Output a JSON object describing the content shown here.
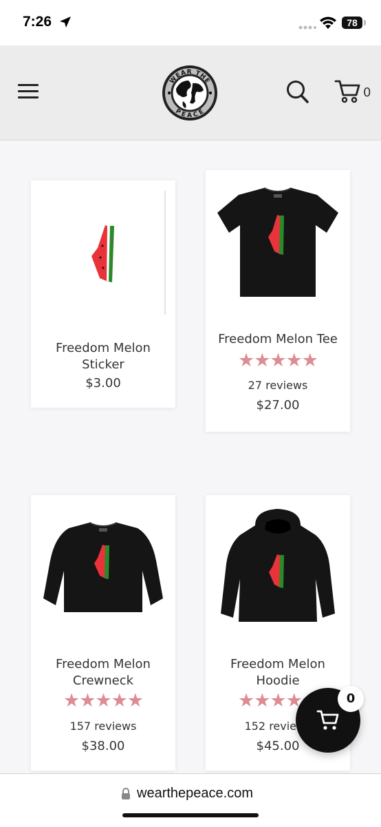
{
  "status_bar": {
    "time": "7:26",
    "battery": "78"
  },
  "header": {
    "logo_text_top": "WEAR THE",
    "logo_text_bottom": "PEACE",
    "cart_count": "0"
  },
  "products": [
    {
      "title_line1": "Freedom Melon",
      "title_line2": "Sticker",
      "price": "$3.00"
    },
    {
      "title_line1": "Freedom Melon Tee",
      "stars": "★★★★★",
      "reviews": "27 reviews",
      "price": "$27.00",
      "rating": 5
    },
    {
      "title_line1": "Freedom Melon",
      "title_line2": "Crewneck",
      "stars": "★★★★★",
      "reviews": "157 reviews",
      "price": "$38.00",
      "rating": 5
    },
    {
      "title_line1": "Freedom Melon",
      "title_line2": "Hoodie",
      "stars": "★★★★★",
      "reviews": "152 reviews",
      "price": "$45.00",
      "rating": 5
    }
  ],
  "floating_cart": {
    "count": "0"
  },
  "browser": {
    "url": "wearthepeace.com"
  },
  "colors": {
    "star": "#dc8c92",
    "header_bg": "#ececec",
    "melon_red": "#e8333a",
    "melon_green": "#2a8a2a"
  }
}
